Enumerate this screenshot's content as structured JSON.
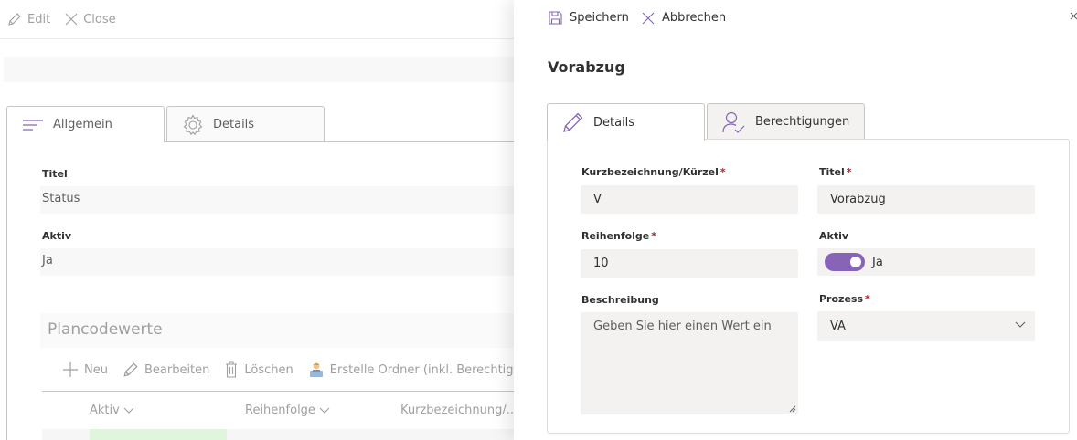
{
  "background": {
    "toolbar": {
      "edit": "Edit",
      "close": "Close"
    },
    "tabs": [
      {
        "label": "Allgemein"
      },
      {
        "label": "Details"
      }
    ],
    "fields": [
      {
        "label": "Titel",
        "value": "Status"
      },
      {
        "label": "Aktiv",
        "value": "Ja"
      }
    ],
    "plancode": {
      "title": "Plancodewerte",
      "commands": {
        "new": "Neu",
        "edit": "Bearbeiten",
        "delete": "Löschen",
        "create_folder": "Erstelle Ordner (inkl. Berechtigung"
      },
      "columns": [
        "Aktiv",
        "Reihenfolge",
        "Kurzbezeichnung/..."
      ]
    }
  },
  "panel": {
    "toolbar": {
      "save": "Speichern",
      "cancel": "Abbrechen"
    },
    "title": "Vorabzug",
    "tabs": [
      {
        "label": "Details",
        "active": true
      },
      {
        "label": "Berechtigungen",
        "active": false
      }
    ],
    "form": {
      "kurz": {
        "label": "Kurzbezeichnung/Kürzel",
        "required": "*",
        "value": "V"
      },
      "titel": {
        "label": "Titel",
        "required": "*",
        "value": "Vorabzug"
      },
      "reihenfolge": {
        "label": "Reihenfolge",
        "required": "*",
        "value": "10"
      },
      "aktiv": {
        "label": "Aktiv",
        "value": "Ja",
        "on": true
      },
      "beschreibung": {
        "label": "Beschreibung",
        "placeholder": "Geben Sie hier einen Wert ein"
      },
      "prozess": {
        "label": "Prozess",
        "required": "*",
        "value": "VA"
      }
    }
  },
  "colors": {
    "accent": "#8764b8",
    "required": "#a4262c",
    "active_cell": "#dff6dd"
  },
  "icons": [
    "pencil-icon",
    "close-icon",
    "save-icon",
    "lines-icon",
    "gear-icon",
    "user-check-icon",
    "plus-icon",
    "trash-icon",
    "folder-person-icon",
    "chevron-down-icon",
    "resize-grip-icon"
  ]
}
